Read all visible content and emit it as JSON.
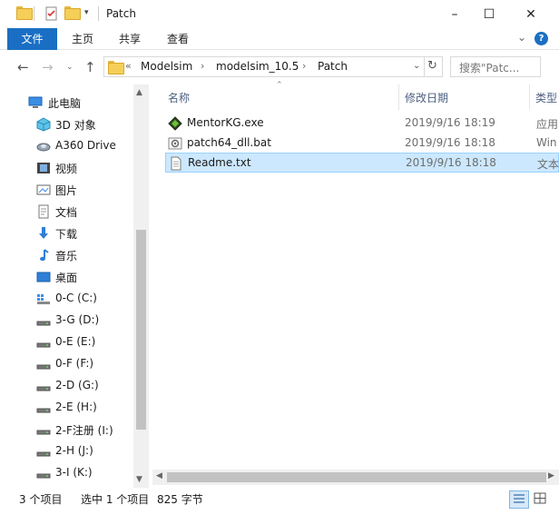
{
  "title_bar": {
    "title": "Patch",
    "minimize": "–",
    "maximize": "☐",
    "close": "✕"
  },
  "ribbon": {
    "tabs": [
      "文件",
      "主页",
      "共享",
      "查看"
    ],
    "expand_glyph": "⌄",
    "help_glyph": "?"
  },
  "address": {
    "overflow": "«",
    "crumbs": [
      "Modelsim",
      "modelsim_10.5",
      "Patch"
    ],
    "separator": "›",
    "search_placeholder": "搜索\"Patc..."
  },
  "nav_pane": {
    "items": [
      {
        "label": "此电脑",
        "icon": "computer-icon"
      },
      {
        "label": "3D 对象",
        "icon": "3d-objects-icon"
      },
      {
        "label": "A360 Drive",
        "icon": "a360-drive-icon"
      },
      {
        "label": "视频",
        "icon": "videos-icon"
      },
      {
        "label": "图片",
        "icon": "pictures-icon"
      },
      {
        "label": "文档",
        "icon": "documents-icon"
      },
      {
        "label": "下载",
        "icon": "downloads-icon"
      },
      {
        "label": "音乐",
        "icon": "music-icon"
      },
      {
        "label": "桌面",
        "icon": "desktop-icon"
      },
      {
        "label": "0-C (C:)",
        "icon": "system-drive-icon"
      },
      {
        "label": "3-G (D:)",
        "icon": "drive-icon"
      },
      {
        "label": "0-E (E:)",
        "icon": "drive-icon"
      },
      {
        "label": "0-F (F:)",
        "icon": "drive-icon"
      },
      {
        "label": "2-D (G:)",
        "icon": "drive-icon"
      },
      {
        "label": "2-E (H:)",
        "icon": "drive-icon"
      },
      {
        "label": "2-F注册 (I:)",
        "icon": "drive-icon"
      },
      {
        "label": "2-H (J:)",
        "icon": "drive-icon"
      },
      {
        "label": "3-I (K:)",
        "icon": "drive-icon"
      }
    ]
  },
  "file_list": {
    "columns": {
      "name": "名称",
      "date": "修改日期",
      "type": "类型"
    },
    "rows": [
      {
        "name": "MentorKG.exe",
        "date": "2019/9/16 18:19",
        "type": "应用",
        "icon": "exe-icon",
        "selected": false
      },
      {
        "name": "patch64_dll.bat",
        "date": "2019/9/16 18:18",
        "type": "Win",
        "icon": "bat-icon",
        "selected": false
      },
      {
        "name": "Readme.txt",
        "date": "2019/9/16 18:18",
        "type": "文本",
        "icon": "txt-icon",
        "selected": true
      }
    ]
  },
  "status_bar": {
    "item_count": "3 个项目",
    "selection": "选中 1 个项目",
    "size": "825 字节"
  },
  "colors": {
    "accent": "#1a6fc4",
    "selection_bg": "#cce8ff",
    "selection_border": "#99d1ff",
    "folder": "#f5cf57"
  }
}
